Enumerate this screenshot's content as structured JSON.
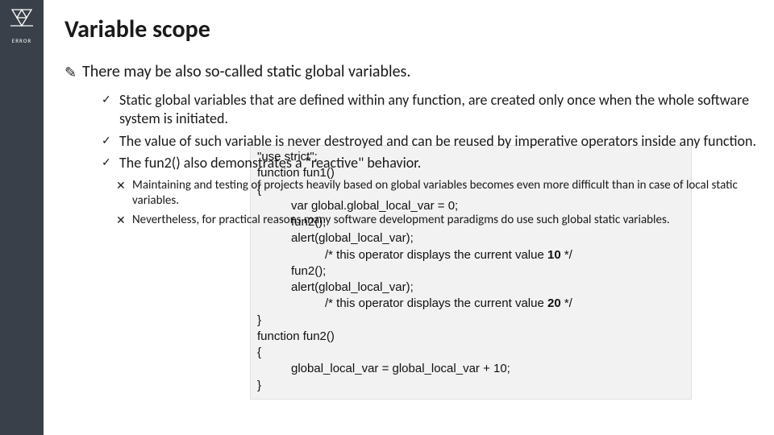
{
  "sidebar": {
    "logo_label": "ERROR"
  },
  "slide": {
    "title": "Variable scope",
    "main_point": "There may be also so-called static global variables.",
    "check_points": [
      "Static global variables that are defined within any function, are created only once when the whole software system is initiated.",
      "The value of such variable is never destroyed and can be reused by imperative operators inside any function.",
      "The fun2() also demonstrates a \"reactive\" behavior."
    ],
    "x_points": [
      "Maintaining and testing of projects heavily based on global variables becomes even more difficult than in case of local static variables.",
      "Nevertheless, for practical reasons many software development paradigms do use such global static variables."
    ]
  },
  "code": {
    "lines": [
      {
        "indent": 1,
        "text": "\"use strict\";"
      },
      {
        "indent": 1,
        "text": "function fun1()"
      },
      {
        "indent": 1,
        "text": "{"
      },
      {
        "indent": 2,
        "text": "var global.global_local_var = 0;"
      },
      {
        "indent": 2,
        "text": "fun2();"
      },
      {
        "indent": 2,
        "text": "alert(global_local_var);"
      },
      {
        "indent": 3,
        "text_html": "/* this operator displays the current value <b>10</b> */"
      },
      {
        "indent": 2,
        "text": "fun2();"
      },
      {
        "indent": 2,
        "text": "alert(global_local_var);"
      },
      {
        "indent": 3,
        "text_html": "/* this operator displays the current value <b>20</b> */"
      },
      {
        "indent": 1,
        "text": "}"
      },
      {
        "indent": 1,
        "text": "function fun2()"
      },
      {
        "indent": 1,
        "text": "{"
      },
      {
        "indent": 2,
        "text": "global_local_var = global_local_var + 10;"
      },
      {
        "indent": 1,
        "text": "}"
      }
    ]
  }
}
